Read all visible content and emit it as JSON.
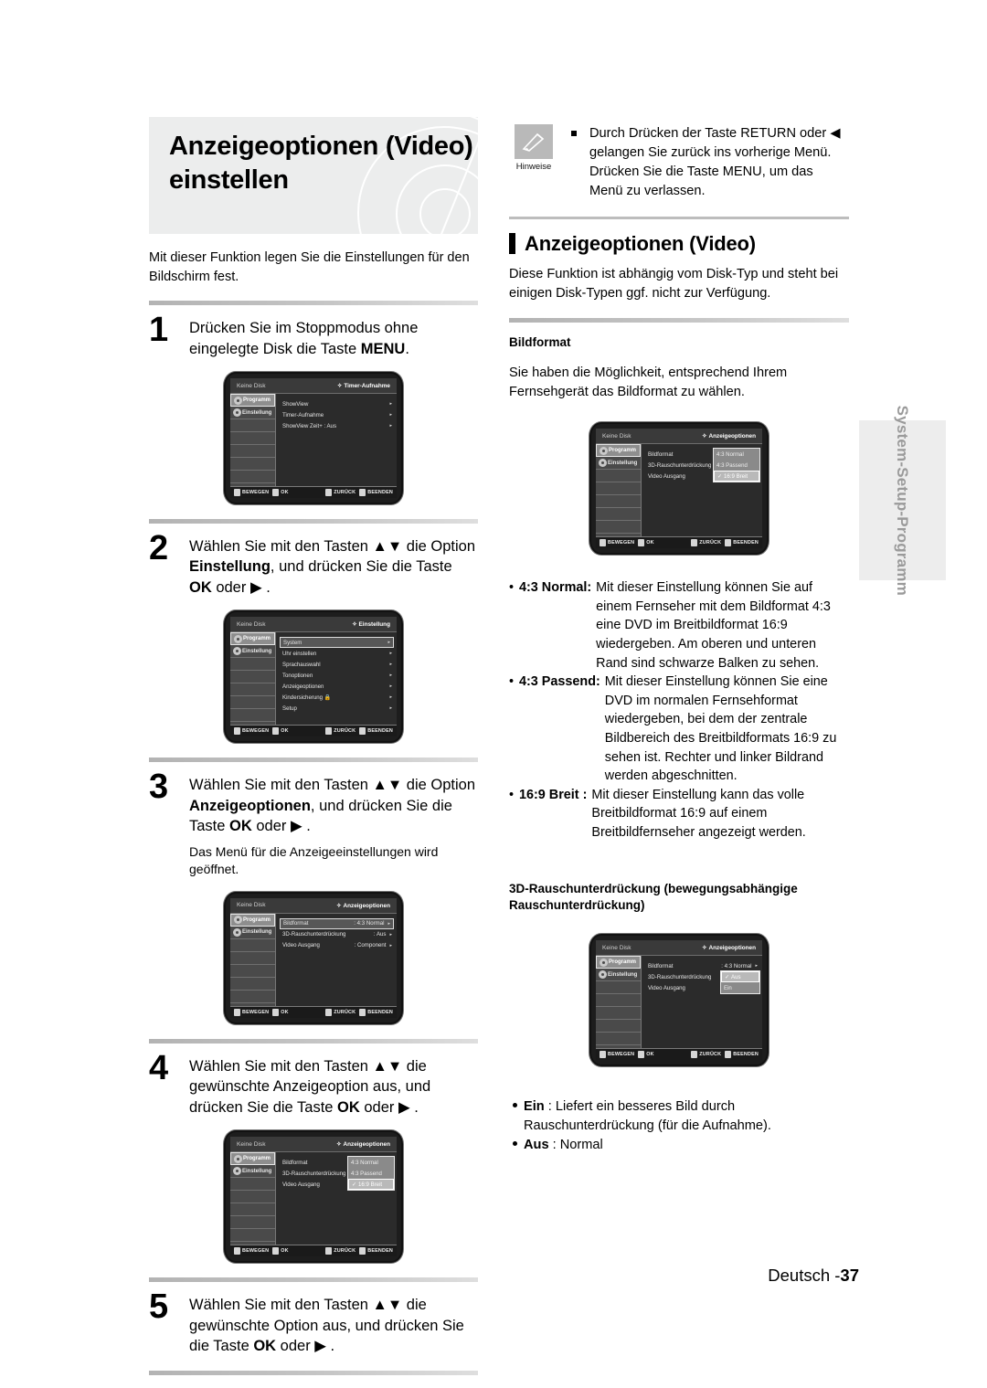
{
  "document": {
    "title": "Anzeigeoptionen (Video) einstellen",
    "title_line1": "Anzeigeoptionen (Video)",
    "title_line2": "einstellen",
    "intro": "Mit dieser Funktion legen Sie die Einstellungen für den Bildschirm fest.",
    "page_footer_label": "Deutsch -",
    "page_number": "37",
    "side_tab": "System-Setup-Programm"
  },
  "steps": [
    {
      "number": "1",
      "text_before": "Drücken Sie im Stoppmodus ohne eingelegte Disk die Taste ",
      "text_bold": "MENU",
      "text_after": ".",
      "sub": ""
    },
    {
      "number": "2",
      "text_before": "Wählen Sie mit den Tasten ▲▼ die Option ",
      "text_bold": "Einstellung",
      "text_mid": ", und drücken Sie die Taste ",
      "text_bold2": "OK",
      "text_after": " oder ▶ .",
      "sub": ""
    },
    {
      "number": "3",
      "text_before": "Wählen Sie mit den Tasten ▲▼ die Option ",
      "text_bold": "Anzeigeoptionen",
      "text_mid": ", und drücken Sie die Taste ",
      "text_bold2": "OK",
      "text_after": " oder ▶ .",
      "sub": "Das Menü für die Anzeigeeinstellungen wird geöffnet."
    },
    {
      "number": "4",
      "text_before": "Wählen Sie mit den Tasten ▲▼ die gewünschte Anzeigeoption aus, und drücken Sie die Taste ",
      "text_bold": "OK",
      "text_after": " oder ▶ .",
      "sub": ""
    },
    {
      "number": "5",
      "text_before": "Wählen Sie mit den Tasten ▲▼ die gewünschte Option aus, und drücken Sie die Taste ",
      "text_bold": "OK",
      "text_after": " oder ▶ .",
      "sub": ""
    }
  ],
  "osd_common": {
    "disk_label": "Keine Disk",
    "diamond": "✧",
    "sidebar": [
      {
        "label": "Programm",
        "icon": "program-icon"
      },
      {
        "label": "Einstellung",
        "icon": "gear-icon"
      }
    ],
    "footer_keys": [
      {
        "key": "updown-key",
        "label": "BEWEGEN"
      },
      {
        "key": "enter-key",
        "label": "OK"
      },
      {
        "key": "return-key",
        "label": "ZURÜCK"
      },
      {
        "key": "menu-key",
        "label": "BEENDEN"
      }
    ]
  },
  "osd_screens": {
    "step1": {
      "crumb": "Timer-Aufnahme",
      "rows": [
        {
          "label": "ShowView",
          "value": "",
          "arrow": "▸",
          "highlight": false
        },
        {
          "label": "Timer-Aufnahme",
          "value": "",
          "arrow": "▸",
          "highlight": false
        },
        {
          "label": "ShowView Zeit+ : Aus",
          "value": "",
          "arrow": "▸",
          "highlight": false
        }
      ]
    },
    "step2": {
      "crumb": "Einstellung",
      "rows": [
        {
          "label": "System",
          "value": "",
          "arrow": "▸",
          "highlight": true
        },
        {
          "label": "Uhr einstellen",
          "value": "",
          "arrow": "▸",
          "highlight": false
        },
        {
          "label": "Sprachauswahl",
          "value": "",
          "arrow": "▸",
          "highlight": false
        },
        {
          "label": "Tonoptionen",
          "value": "",
          "arrow": "▸",
          "highlight": false
        },
        {
          "label": "Anzeigeoptionen",
          "value": "",
          "arrow": "▸",
          "highlight": false
        },
        {
          "label": "Kindersicherung 🔒",
          "value": "",
          "arrow": "▸",
          "highlight": false
        },
        {
          "label": "Setup",
          "value": "",
          "arrow": "▸",
          "highlight": false
        }
      ]
    },
    "step3": {
      "crumb": "Anzeigeoptionen",
      "rows": [
        {
          "label": "Bildformat",
          "value": ": 4:3 Normal",
          "arrow": "▸",
          "highlight": true
        },
        {
          "label": "3D-Rauschunterdrückung",
          "value": ": Aus",
          "arrow": "▸",
          "highlight": false
        },
        {
          "label": "Video Ausgang",
          "value": ": Component",
          "arrow": "▸",
          "highlight": false
        }
      ]
    },
    "step4": {
      "crumb": "Anzeigeoptionen",
      "rows": [
        {
          "label": "Bildformat",
          "value": "",
          "arrow": "",
          "highlight": false
        },
        {
          "label": "3D-Rauschunterdrückung",
          "value": "",
          "arrow": "",
          "highlight": false
        },
        {
          "label": "Video Ausgang",
          "value": "",
          "arrow": "",
          "highlight": false
        }
      ],
      "popup": {
        "items": [
          {
            "label": "4:3 Normal",
            "checked": false,
            "selected": false
          },
          {
            "label": "4:3 Passend",
            "checked": false,
            "selected": false
          },
          {
            "label": "16:9 Breit",
            "checked": true,
            "selected": true
          }
        ]
      }
    },
    "bildformat": {
      "crumb": "Anzeigeoptionen",
      "rows": [
        {
          "label": "Bildformat",
          "value": "",
          "arrow": "",
          "highlight": false
        },
        {
          "label": "3D-Rauschunterdrückung",
          "value": "",
          "arrow": "",
          "highlight": false
        },
        {
          "label": "Video Ausgang",
          "value": "",
          "arrow": "",
          "highlight": false
        }
      ],
      "popup": {
        "items": [
          {
            "label": "4:3 Normal",
            "checked": false,
            "selected": false
          },
          {
            "label": "4:3 Passend",
            "checked": false,
            "selected": false
          },
          {
            "label": "16:9 Breit",
            "checked": true,
            "selected": true
          }
        ]
      }
    },
    "noise": {
      "crumb": "Anzeigeoptionen",
      "rows": [
        {
          "label": "Bildformat",
          "value": ": 4:3 Normal",
          "arrow": "▸",
          "highlight": false
        },
        {
          "label": "3D-Rauschunterdrückung",
          "value": "",
          "arrow": "",
          "highlight": false
        },
        {
          "label": "Video Ausgang",
          "value": "",
          "arrow": "",
          "highlight": false
        }
      ],
      "popup": {
        "items": [
          {
            "label": "Aus",
            "checked": true,
            "selected": true
          },
          {
            "label": "Ein",
            "checked": false,
            "selected": false
          }
        ]
      }
    }
  },
  "note": {
    "caption": "Hinweise",
    "icon": "pencil-icon",
    "text": "Durch Drücken der Taste RETURN oder ◀ gelangen Sie zurück ins vorherige Menü. Drücken Sie die Taste MENU, um das Menü zu verlassen."
  },
  "right": {
    "section_title": "Anzeigeoptionen (Video)",
    "section_intro": "Diese Funktion ist abhängig vom Disk-Typ und steht bei einigen Disk-Typen ggf. nicht zur Verfügung.",
    "bildformat_heading": "Bildformat",
    "bildformat_intro": "Sie haben die Möglichkeit, entsprechend Ihrem Fernsehgerät das Bildformat zu wählen.",
    "format_defs": [
      {
        "bullet": "•",
        "term": "4:3 Normal:",
        "desc": "Mit dieser Einstellung können Sie auf einem Fernseher mit dem Bildformat 4:3 eine DVD im Breitbildformat 16:9 wiedergeben. Am oberen und unteren Rand sind schwarze Balken zu sehen."
      },
      {
        "bullet": "•",
        "term": "4:3 Passend:",
        "desc": "Mit dieser Einstellung können Sie eine DVD im normalen Fernsehformat wiedergeben, bei dem der zentrale Bildbereich des Breitbildformats 16:9 zu sehen ist. Rechter und linker Bildrand werden abgeschnitten."
      },
      {
        "bullet": "•",
        "term": "16:9 Breit :",
        "desc": "Mit dieser Einstellung kann das volle Breitbildformat 16:9 auf einem Breitbildfernseher angezeigt werden."
      }
    ],
    "noise_heading_line1": "3D-Rauschunterdrückung (bewegungsabhängige",
    "noise_heading_line2": "Rauschunterdrückung)",
    "noise_bullets": [
      {
        "term": "Ein",
        "desc": " : Liefert ein besseres Bild durch Rauschunterdrückung (für die Aufnahme)."
      },
      {
        "term": "Aus",
        "desc": " : Normal"
      }
    ]
  }
}
